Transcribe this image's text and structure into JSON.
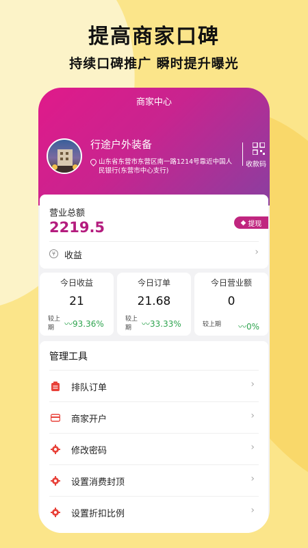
{
  "promo": {
    "headline": "提高商家口碑",
    "subheadline": "持续口碑推广 瞬时提升曝光"
  },
  "header": {
    "title": "商家中心",
    "shop_name": "行途户外装备",
    "address": "山东省东营市东营区南一路1214号靠近中国人民银行(东营市中心支行)",
    "qr_label": "收款码"
  },
  "revenue": {
    "label": "营业总额",
    "value": "2219.5",
    "withdraw_label": "提现",
    "earnings_label": "收益"
  },
  "stats": [
    {
      "title": "今日收益",
      "value": "21",
      "compare_label": "较上期",
      "trend": "93.36%"
    },
    {
      "title": "今日订单",
      "value": "21.68",
      "compare_label": "较上期",
      "trend": "33.33%"
    },
    {
      "title": "今日营业额",
      "value": "0",
      "compare_label": "较上期",
      "trend": "0%"
    }
  ],
  "tools": {
    "title": "管理工具",
    "items": [
      {
        "label": "排队订单",
        "icon": "clipboard-icon"
      },
      {
        "label": "商家开户",
        "icon": "card-icon"
      },
      {
        "label": "修改密码",
        "icon": "gear-icon"
      },
      {
        "label": "设置消费封顶",
        "icon": "gear-icon"
      },
      {
        "label": "设置折扣比例",
        "icon": "gear-icon"
      }
    ]
  },
  "colors": {
    "accent": "#c0267f",
    "trend_up": "#2ea44f",
    "background": "#fbe58a"
  }
}
